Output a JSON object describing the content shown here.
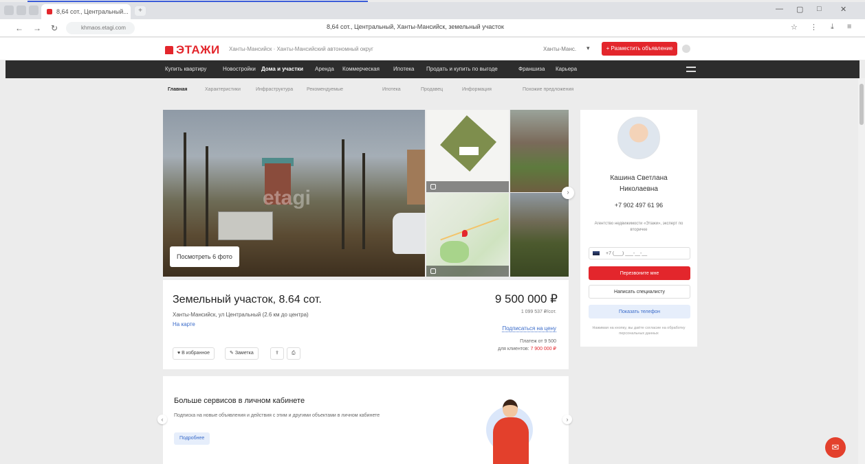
{
  "browser": {
    "tab_title": "8,64 сот., Центральный...",
    "new_tab": "+",
    "page_title": "8,64 сот., Центральный, Ханты-Мансийск, земельный участок",
    "address": "khmaos.etagi.com"
  },
  "site": {
    "logo": "ЭТАЖИ",
    "region": "Ханты-Мансийск · Ханты-Мансийский автономный округ",
    "city": "Ханты-Манс.",
    "post_button": "+ Разместить объявление"
  },
  "main_nav": [
    "Купить квартиру",
    "Новостройки",
    "Дома и участки",
    "Аренда",
    "Коммерческая",
    "Ипотека",
    "Продать и купить по выгоде",
    "Франшиза",
    "Карьера"
  ],
  "main_nav_active": "Дома и участки",
  "sub_nav": [
    "Главная",
    "Характеристики",
    "Инфраструктура",
    "Рекомендуемые",
    "Ипотека",
    "Продавец",
    "Информация",
    "Похожие предложения"
  ],
  "sub_nav_active": "Главная",
  "gallery": {
    "watermark": "etagi",
    "show_photos": "Посмотреть 6 фото",
    "next_label": "›"
  },
  "listing": {
    "title": "Земельный участок, 8.64 сот.",
    "address": "Ханты-Мансийск, ул Центральный (2.6 км до центра)",
    "map_link": "На карте",
    "actions": [
      "В избранное",
      "Заметка"
    ],
    "price": "9 500 000 ₽",
    "price_sub": "1 099 537 ₽/сот.",
    "price_link": "Подписаться на цену",
    "mortgage_line1": "Платеж от 9 500",
    "mortgage_line2": "для клиентов:",
    "mortgage_value": "7 900 000 ₽"
  },
  "promo": {
    "title": "Больше сервисов в личном кабинете",
    "text": "Подписка на новые объявления и действия с этим и другими объектами в личном кабинете",
    "button": "Подробнее"
  },
  "agent": {
    "name_line1": "Кашина Светлана",
    "name_line2": "Николаевна",
    "phone": "+7 902 497 61 96",
    "note": "Агентство недвижимости «Этажи», эксперт по вторичке",
    "phone_placeholder": "+7 (___) ___-__-__",
    "call_button": "Перезвоните мне",
    "message_button": "Написать специалисту",
    "show_phone_button": "Показать телефон",
    "footer": "Нажимая на кнопку, вы даёте согласие на обработку персональных данных"
  },
  "chat": {
    "icon": "chat-icon"
  }
}
